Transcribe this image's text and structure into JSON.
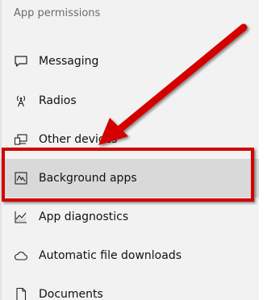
{
  "section_title": "App permissions",
  "nav_items": [
    {
      "label": "Messaging",
      "icon": "message-icon"
    },
    {
      "label": "Radios",
      "icon": "radio-antenna-icon"
    },
    {
      "label": "Other devices",
      "icon": "other-devices-icon"
    },
    {
      "label": "Background apps",
      "icon": "background-apps-icon",
      "selected": true
    },
    {
      "label": "App diagnostics",
      "icon": "app-diagnostics-icon"
    },
    {
      "label": "Automatic file downloads",
      "icon": "cloud-icon"
    },
    {
      "label": "Documents",
      "icon": "document-icon"
    }
  ],
  "annotation": {
    "color": "#d40000",
    "highlighted_item": "Background apps"
  },
  "colors": {
    "panel_background": "#f2f2f2",
    "selected_background": "#d9d9d9"
  }
}
